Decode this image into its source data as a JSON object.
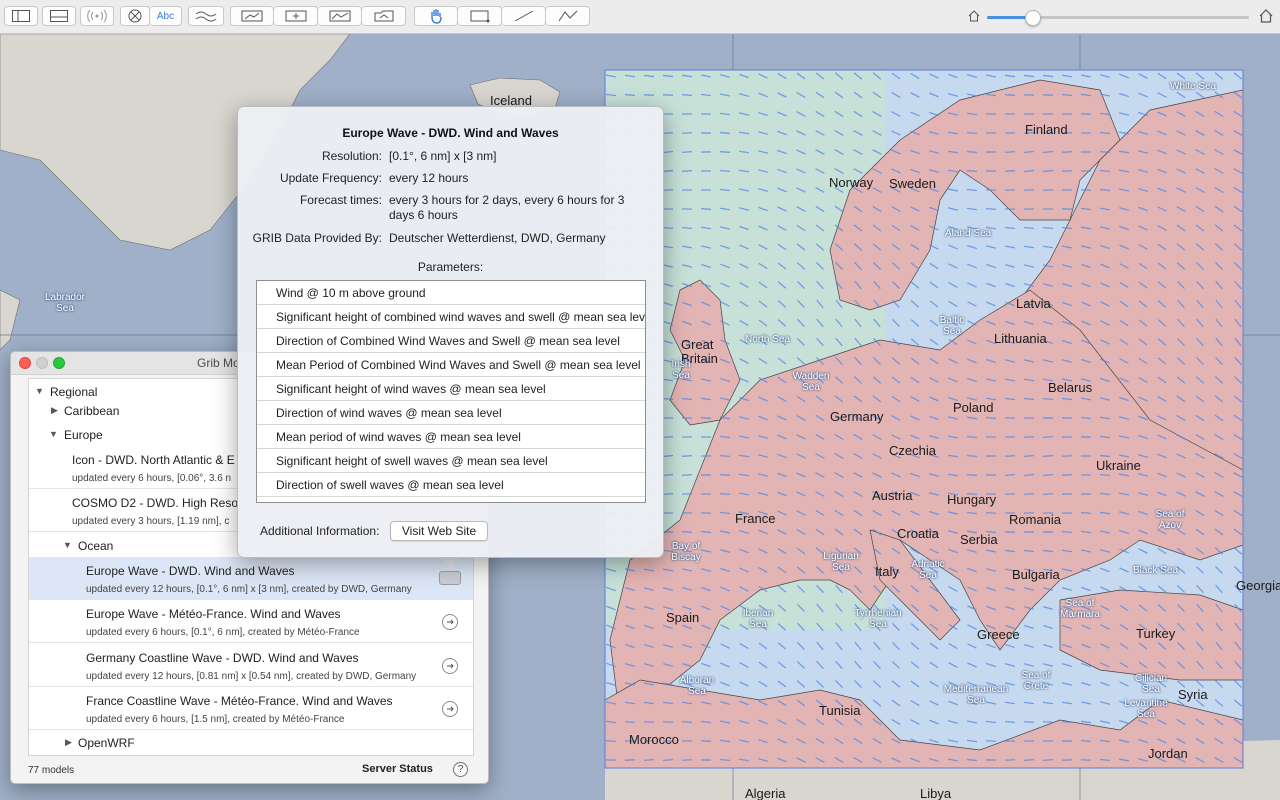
{
  "toolbar": {
    "abc_label": "Abc",
    "zoom_level": 0.17
  },
  "map": {
    "countries": [
      "Iceland",
      "Finland",
      "Norway",
      "Sweden",
      "Latvia",
      "Lithuania",
      "Great Britain",
      "Belarus",
      "Poland",
      "Germany",
      "Czechia",
      "Ukraine",
      "Austria",
      "Hungary",
      "France",
      "Romania",
      "Croatia",
      "Serbia",
      "Italy",
      "Bulgaria",
      "Spain",
      "Greece",
      "Turkey",
      "Georgia",
      "Syria",
      "Tunisia",
      "Morocco",
      "Jordan",
      "Algeria",
      "Libya"
    ],
    "seas": [
      "White Sea",
      "Aland Sea",
      "Baltic Sea",
      "North Sea",
      "Wadden Sea",
      "Irish Sea",
      "Labrador Sea",
      "Bay of Biscay",
      "Ligurian Sea",
      "Adriatic Sea",
      "Black Sea",
      "Sea of Azov",
      "Iberian Sea",
      "Tyrrhenian Sea",
      "Sea of Marmara",
      "Alboran Sea",
      "Sea of Crete",
      "Mediterranean Sea",
      "Cilician Sea",
      "Levantine Sea"
    ]
  },
  "grib_window": {
    "title": "Grib Mo",
    "tree": {
      "regional": "Regional",
      "caribbean": "Caribbean",
      "europe": "Europe",
      "ocean": "Ocean",
      "openwrf": "OpenWRF"
    },
    "models_top": [
      {
        "name": "Icon - DWD.  North Atlantic & E",
        "desc": "updated every 6 hours, [0.06°, 3.6 n"
      },
      {
        "name": "COSMO D2 - DWD.  High Reso",
        "desc": "updated every 3 hours, [1.19 nm], c"
      }
    ],
    "models_ocean": [
      {
        "name": "Europe Wave - DWD.  Wind and Waves",
        "desc": "updated every 12 hours, [0.1°, 6 nm] x [3 nm], created by DWD, Germany",
        "selected": true
      },
      {
        "name": "Europe Wave - Météo-France.  Wind and Waves",
        "desc": "updated every 6 hours, [0.1°, 6 nm], created by Météo-France",
        "selected": false
      },
      {
        "name": "Germany Coastline Wave - DWD.  Wind and Waves",
        "desc": "updated every 12 hours, [0.81 nm] x [0.54 nm], created by DWD, Germany",
        "selected": false
      },
      {
        "name": "France Coastline Wave - Météo-France.  Wind and Waves",
        "desc": "updated every 6 hours, [1.5 nm], created by Météo-France",
        "selected": false
      }
    ],
    "model_count": "77 models",
    "server_status": "Server Status",
    "help": "?"
  },
  "popover": {
    "title": "Europe Wave - DWD.  Wind and Waves",
    "resolution_label": "Resolution:",
    "resolution_value": "[0.1°, 6 nm] x [3 nm]",
    "update_label": "Update Frequency:",
    "update_value": "every 12 hours",
    "forecast_label": "Forecast times:",
    "forecast_value": "every 3 hours for 2 days, every 6 hours for 3 days 6 hours",
    "provider_label": "GRIB Data Provided By:",
    "provider_value": "Deutscher Wetterdienst, DWD, Germany",
    "parameters_header": "Parameters:",
    "parameters": [
      "Wind @ 10 m above ground",
      "Significant height of combined wind waves and swell @ mean sea level",
      "Direction of Combined Wind Waves and Swell @ mean sea level",
      "Mean Period of Combined Wind Waves and Swell @ mean sea level",
      "Significant height of wind waves @ mean sea level",
      "Direction of wind waves @ mean sea level",
      "Mean period of wind waves @ mean sea level",
      "Significant height of swell waves @ mean sea level",
      "Direction of swell waves @ mean sea level"
    ],
    "additional_label": "Additional Information:",
    "visit_button": "Visit Web Site"
  },
  "colors": {
    "land_grib": "#e3b4b4",
    "sea_grib": "#c7d9ee",
    "sea_outside": "#9fb0c8",
    "land_outside": "#d9d6d0",
    "grib_border": "#5f7cdb",
    "arrow": "#4f8ae6"
  }
}
